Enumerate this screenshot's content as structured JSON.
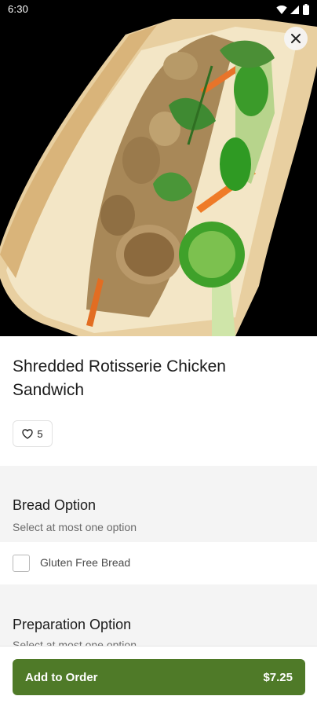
{
  "status_bar": {
    "time": "6:30",
    "icons": [
      "wifi-icon",
      "cellular-signal-icon",
      "battery-icon"
    ]
  },
  "hero": {
    "image_subject": "shredded rotisserie chicken sandwich on a baguette with cilantro, jalapeño, pickled carrot and cucumber",
    "close_icon": "close-icon"
  },
  "item": {
    "title": "Shredded Rotisserie Chicken Sandwich",
    "likes": "5",
    "like_icon": "heart-outline-icon"
  },
  "options": [
    {
      "heading": "Bread Option",
      "subtitle": "Select at most one option",
      "choices": [
        {
          "label": "Gluten Free Bread",
          "checked": false
        }
      ]
    },
    {
      "heading": "Preparation Option",
      "subtitle": "Select at most one option"
    }
  ],
  "cart": {
    "add_label": "Add to Order",
    "price": "$7.25"
  },
  "colors": {
    "accent": "#4f7a28",
    "section_bg": "#f4f4f4",
    "hero_bg": "#000000"
  }
}
